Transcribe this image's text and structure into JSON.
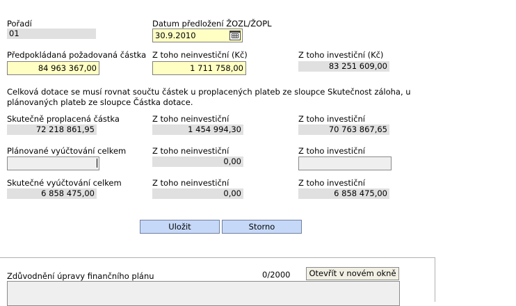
{
  "poradi": {
    "label": "Pořadí",
    "value": "01"
  },
  "datum": {
    "label": "Datum předložení ŽOZL/ŽOPL",
    "value": "30.9.2010"
  },
  "predpokladana": {
    "label": "Předpokládaná požadovaná částka",
    "value": "84 963 367,00"
  },
  "predpokladana_neinv": {
    "label": "Z toho neinvestiční (Kč)",
    "value": "1 711 758,00"
  },
  "predpokladana_inv": {
    "label": "Z toho investiční (Kč)",
    "value": "83 251 609,00"
  },
  "note": {
    "line1": "Celková dotace se musí rovnat součtu částek u proplacených plateb ze sloupce Skutečnost záloha, u",
    "line2": "plánovaných plateb ze sloupce Částka dotace."
  },
  "skutecne_proplacena": {
    "label": "Skutečně proplacená částka",
    "value": "72 218 861,95"
  },
  "skutecne_proplacena_neinv": {
    "label": "Z toho neinvestiční",
    "value": "1 454 994,30"
  },
  "skutecne_proplacena_inv": {
    "label": "Z toho investiční",
    "value": "70 763 867,65"
  },
  "planovane": {
    "label": "Plánované vyúčtování celkem",
    "value": ""
  },
  "planovane_neinv": {
    "label": "Z toho neinvestiční",
    "value": "0,00"
  },
  "planovane_inv": {
    "label": "Z toho investiční",
    "value": ""
  },
  "skutecne_vyuct": {
    "label": "Skutečné vyúčtování celkem",
    "value": "6 858 475,00"
  },
  "skutecne_vyuct_neinv": {
    "label": "Z toho neinvestiční",
    "value": "0,00"
  },
  "skutecne_vyuct_inv": {
    "label": "Z toho investiční",
    "value": "6 858 475,00"
  },
  "buttons": {
    "save": "Uložit",
    "cancel": "Storno"
  },
  "zduvodneni": {
    "label": "Zdůvodnění úpravy finančního plánu",
    "counter": "0/2000",
    "open_button": "Otevřít v novém okně",
    "value": ""
  },
  "icons": {
    "calendar": "calendar-icon"
  },
  "colors": {
    "readonly_bg": "#e0e0e0",
    "editable_bg": "#ffffc4",
    "button_bg": "#c6d8f8"
  }
}
